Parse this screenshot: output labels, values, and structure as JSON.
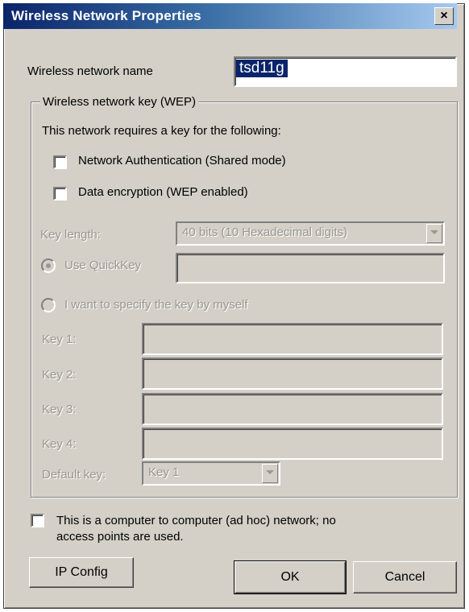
{
  "window": {
    "title": "Wireless Network Properties",
    "close_glyph": "×"
  },
  "network_name": {
    "label": "Wireless network name",
    "value": "tsd11g"
  },
  "wep_group": {
    "legend": "Wireless network key (WEP)",
    "requires_text": "This network requires a key for the following:",
    "auth_label": "Network  Authentication (Shared mode)",
    "encryption_label": "Data encryption (WEP enabled)",
    "key_length_label": "Key length:",
    "key_length_value": "40 bits (10 Hexadecimal digits)",
    "use_quickkey_label": "Use QuickKey",
    "specify_key_label": "I want to specify the key by myself",
    "keys": [
      "Key 1:",
      "Key 2:",
      "Key 3:",
      "Key 4:"
    ],
    "default_key_label": "Default key:",
    "default_key_value": "Key 1"
  },
  "adhoc": {
    "line1": "This is a computer to computer (ad hoc) network; no",
    "line2": "access points are used."
  },
  "buttons": {
    "ip_config": "IP Config",
    "ok": "OK",
    "cancel": "Cancel"
  }
}
